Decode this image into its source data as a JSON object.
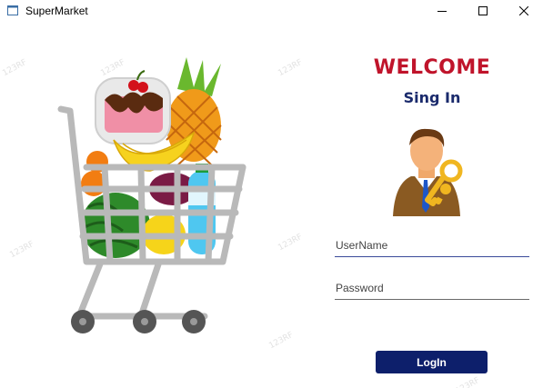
{
  "window": {
    "title": "SuperMarket",
    "icon": "app-window-icon",
    "controls": [
      "minimize-icon",
      "maximize-icon",
      "close-icon"
    ]
  },
  "login": {
    "heading": "WELCOME",
    "subheading": "Sing In",
    "username_placeholder": "UserName",
    "password_placeholder": "Password",
    "login_label": "LogIn"
  },
  "images": {
    "cart": "shopping-cart-fruits-image",
    "avatar": "user-with-key-icon"
  },
  "watermark": "123RF",
  "colors": {
    "heading": "#c0142b",
    "subheading": "#1a2a6c",
    "button_bg": "#0d1f6b",
    "button_text": "#ffffff"
  }
}
